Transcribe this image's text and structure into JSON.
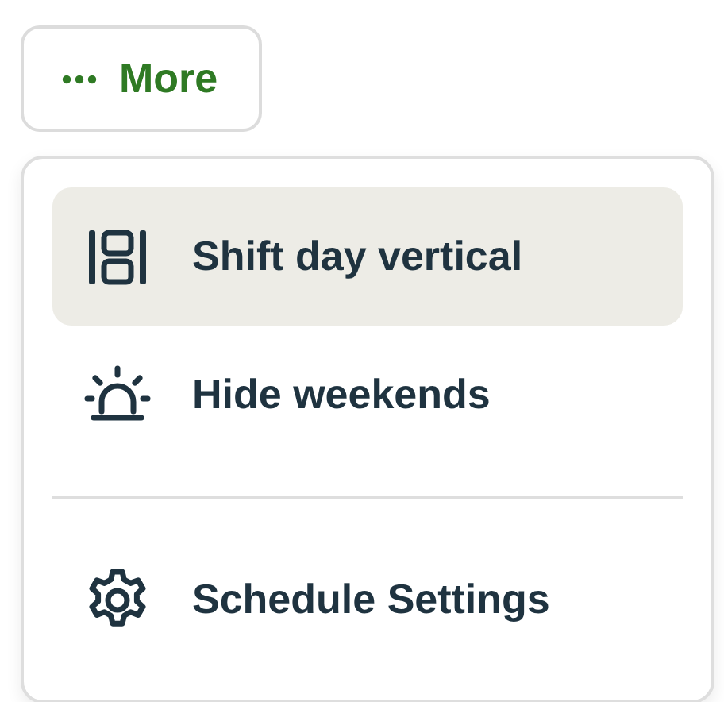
{
  "more_button": {
    "label": "More"
  },
  "menu": {
    "sections": [
      [
        {
          "label": "Shift day vertical",
          "selected": true
        },
        {
          "label": "Hide weekends",
          "selected": false
        }
      ],
      [
        {
          "label": "Schedule Settings",
          "selected": false
        }
      ]
    ]
  }
}
